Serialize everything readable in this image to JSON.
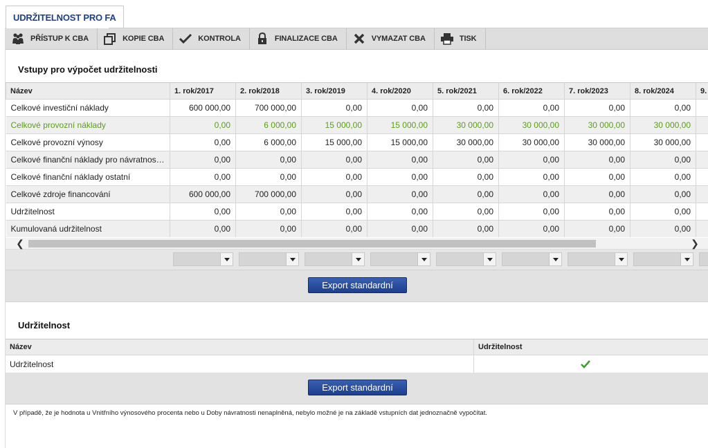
{
  "tab": {
    "label": "UDRŽITELNOST PRO FA"
  },
  "toolbar": [
    {
      "label": "PŘÍSTUP K CBA",
      "icon": "users-icon"
    },
    {
      "label": "KOPIE CBA",
      "icon": "copy-icon"
    },
    {
      "label": "KONTROLA",
      "icon": "check-icon"
    },
    {
      "label": "FINALIZACE CBA",
      "icon": "lock-icon"
    },
    {
      "label": "VYMAZAT CBA",
      "icon": "delete-icon"
    },
    {
      "label": "TISK",
      "icon": "print-icon"
    }
  ],
  "inputs_section": {
    "title": "Vstupy pro výpočet udržitelnosti",
    "columns": [
      "Název",
      "1. rok/2017",
      "2. rok/2018",
      "3. rok/2019",
      "4. rok/2020",
      "5. rok/2021",
      "6. rok/2022",
      "7. rok/2023",
      "8. rok/2024",
      "9."
    ],
    "rows": [
      {
        "name": "Celkové investiční náklady",
        "values": [
          "600 000,00",
          "700 000,00",
          "0,00",
          "0,00",
          "0,00",
          "0,00",
          "0,00",
          "0,00"
        ]
      },
      {
        "name": "Celkové provozní náklady",
        "values": [
          "0,00",
          "6 000,00",
          "15 000,00",
          "15 000,00",
          "30 000,00",
          "30 000,00",
          "30 000,00",
          "30 000,00"
        ]
      },
      {
        "name": "Celkové provozní výnosy",
        "values": [
          "0,00",
          "6 000,00",
          "15 000,00",
          "15 000,00",
          "30 000,00",
          "30 000,00",
          "30 000,00",
          "30 000,00"
        ]
      },
      {
        "name": "Celkové finanční náklady pro návratnost i...",
        "values": [
          "0,00",
          "0,00",
          "0,00",
          "0,00",
          "0,00",
          "0,00",
          "0,00",
          "0,00"
        ]
      },
      {
        "name": "Celkové finanční náklady ostatní",
        "values": [
          "0,00",
          "0,00",
          "0,00",
          "0,00",
          "0,00",
          "0,00",
          "0,00",
          "0,00"
        ]
      },
      {
        "name": "Celkové zdroje financování",
        "values": [
          "600 000,00",
          "700 000,00",
          "0,00",
          "0,00",
          "0,00",
          "0,00",
          "0,00",
          "0,00"
        ]
      },
      {
        "name": "Udržitelnost",
        "values": [
          "0,00",
          "0,00",
          "0,00",
          "0,00",
          "0,00",
          "0,00",
          "0,00",
          "0,00"
        ]
      },
      {
        "name": "Kumulovaná udržitelnost",
        "values": [
          "0,00",
          "0,00",
          "0,00",
          "0,00",
          "0,00",
          "0,00",
          "0,00",
          "0,00"
        ]
      }
    ],
    "export_label": "Export standardní"
  },
  "sustainability_section": {
    "title": "Udržitelnost",
    "columns": [
      "Název",
      "Udržitelnost"
    ],
    "row_name": "Udržitelnost",
    "export_label": "Export standardní"
  },
  "note": "V případě, že je hodnota u Vnitřního výnosového procenta nebo u Doby návratnosti nenaplněná, nebylo možné je na základě vstupních dat jednoznačně vypočítat.",
  "colors": {
    "accent": "#1b3f8b",
    "highlight_row": "#5a9e1a",
    "check": "#3aa02a"
  }
}
